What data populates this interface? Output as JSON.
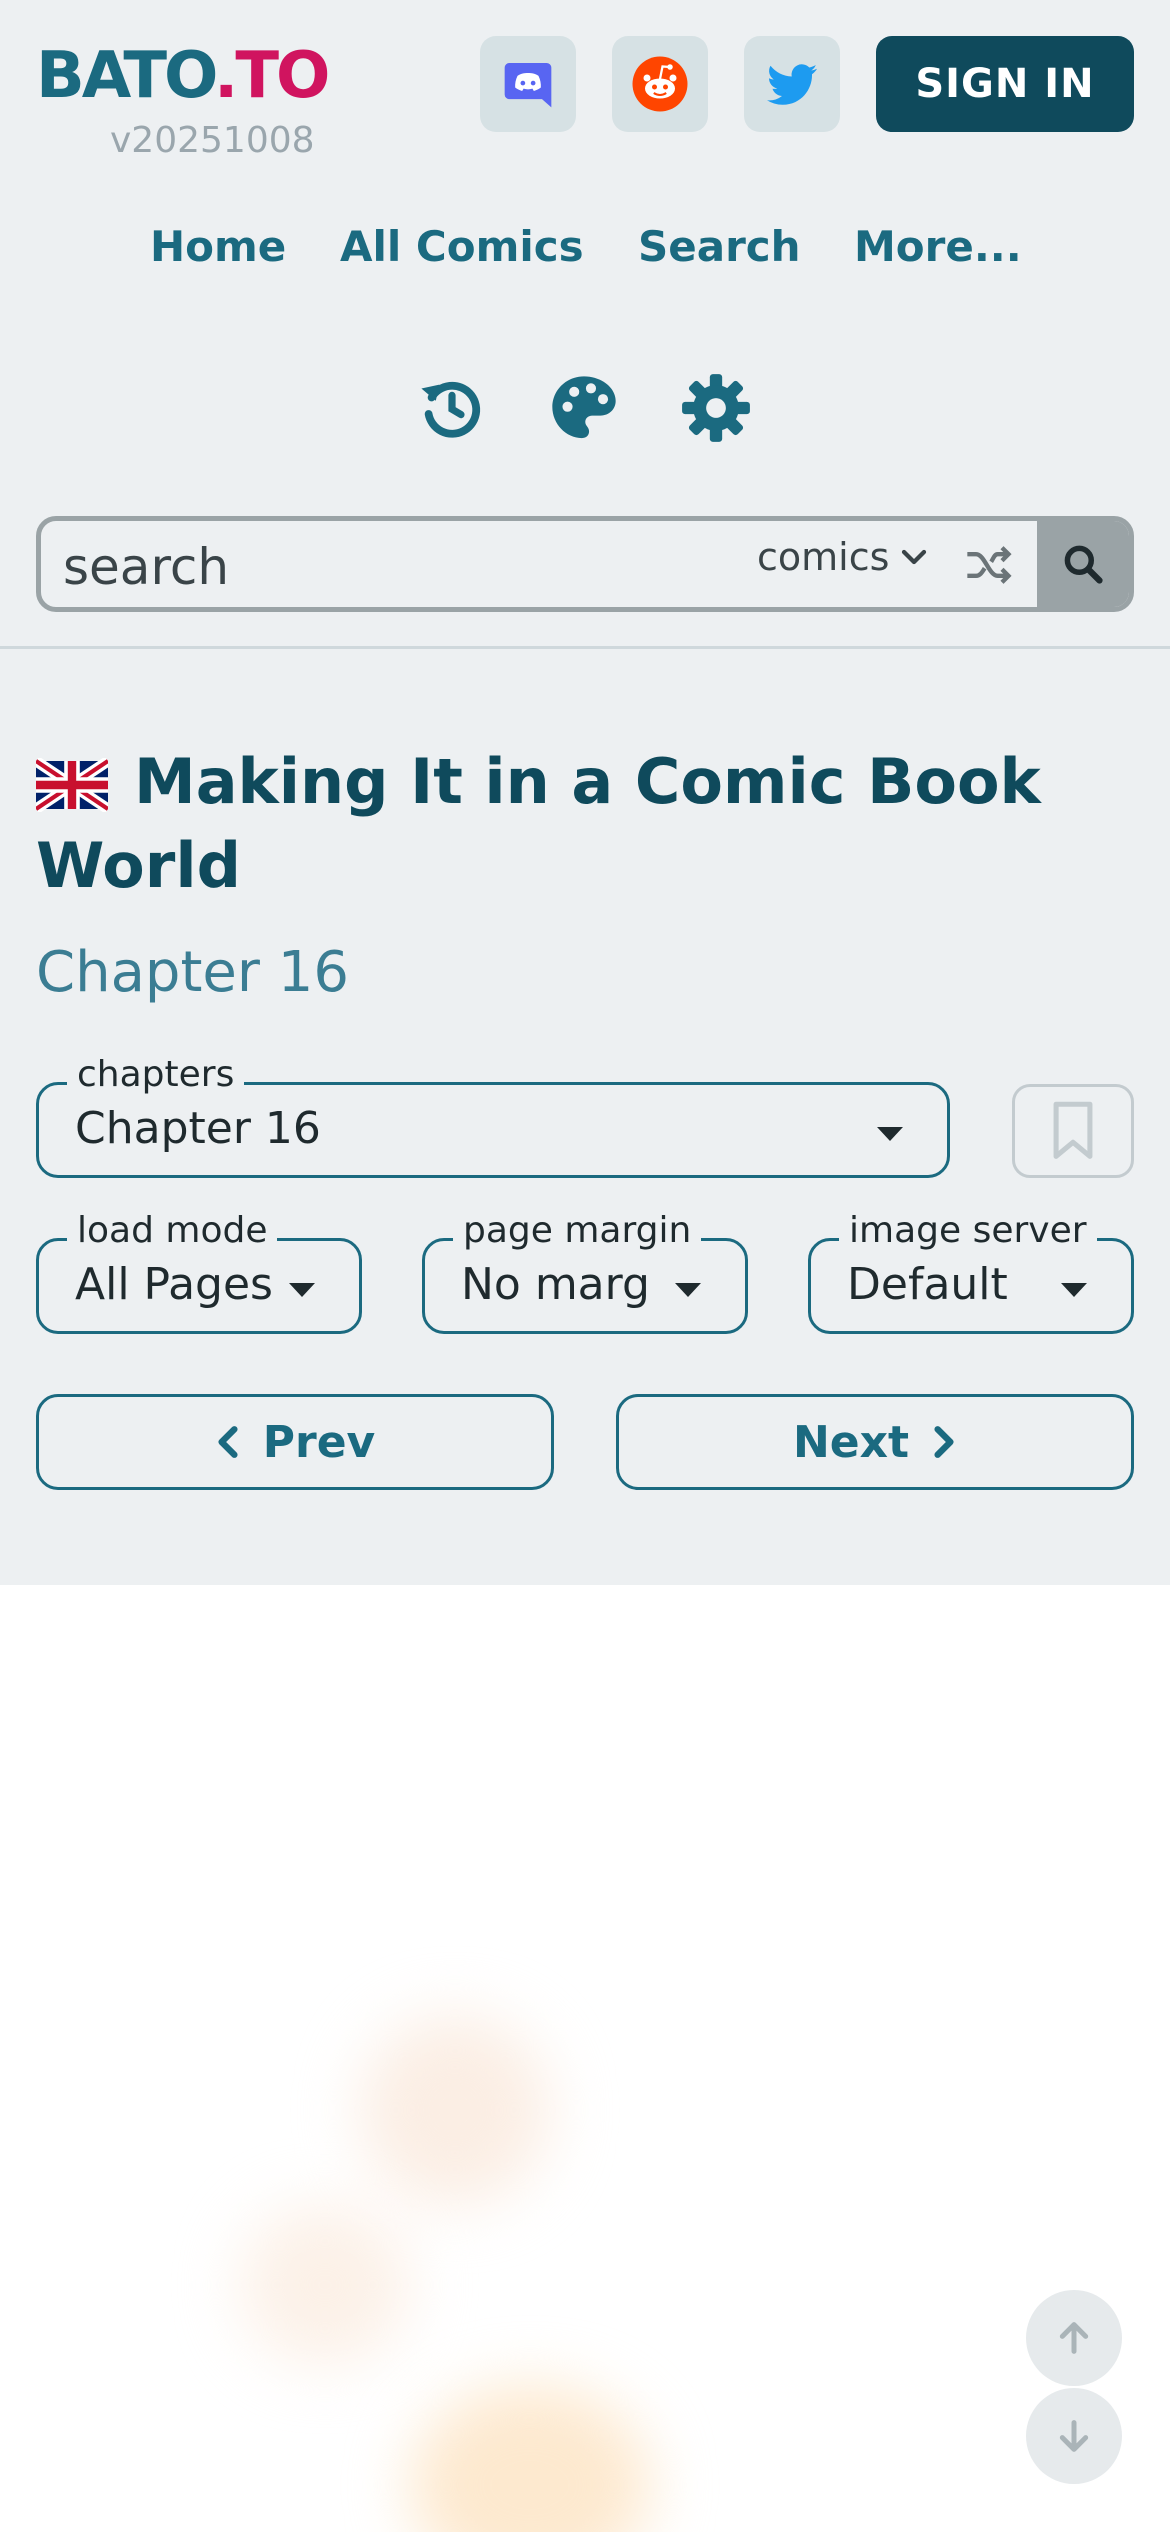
{
  "header": {
    "logo_primary": "BATO",
    "logo_secondary": ".TO",
    "version": "v20251008",
    "sign_in_label": "SIGN IN",
    "social": [
      {
        "name": "discord-icon",
        "color": "#5865f2"
      },
      {
        "name": "reddit-icon",
        "color": "#ff4500"
      },
      {
        "name": "twitter-icon",
        "color": "#1d9bf0"
      }
    ]
  },
  "nav": {
    "items": [
      {
        "label": "Home"
      },
      {
        "label": "All Comics"
      },
      {
        "label": "Search"
      },
      {
        "label": "More..."
      }
    ]
  },
  "tools": [
    "history-icon",
    "palette-icon",
    "gear-icon"
  ],
  "search": {
    "placeholder": "search",
    "scope": "comics"
  },
  "comic": {
    "language_flag": "uk-flag-icon",
    "title": "Making It in a Comic Book World",
    "chapter": "Chapter 16"
  },
  "controls": {
    "chapters": {
      "legend": "chapters",
      "value": "Chapter 16"
    },
    "load_mode": {
      "legend": "load mode",
      "value": "All Pages"
    },
    "page_margin": {
      "legend": "page margin",
      "value": "No margin"
    },
    "image_server": {
      "legend": "image server",
      "value": "Default"
    }
  },
  "pager": {
    "prev_label": "Prev",
    "next_label": "Next"
  },
  "colors": {
    "primary": "#0f4a5c",
    "accent": "#1b6a80",
    "logo_pink": "#d0145f",
    "header_bg": "#edf0f2"
  }
}
